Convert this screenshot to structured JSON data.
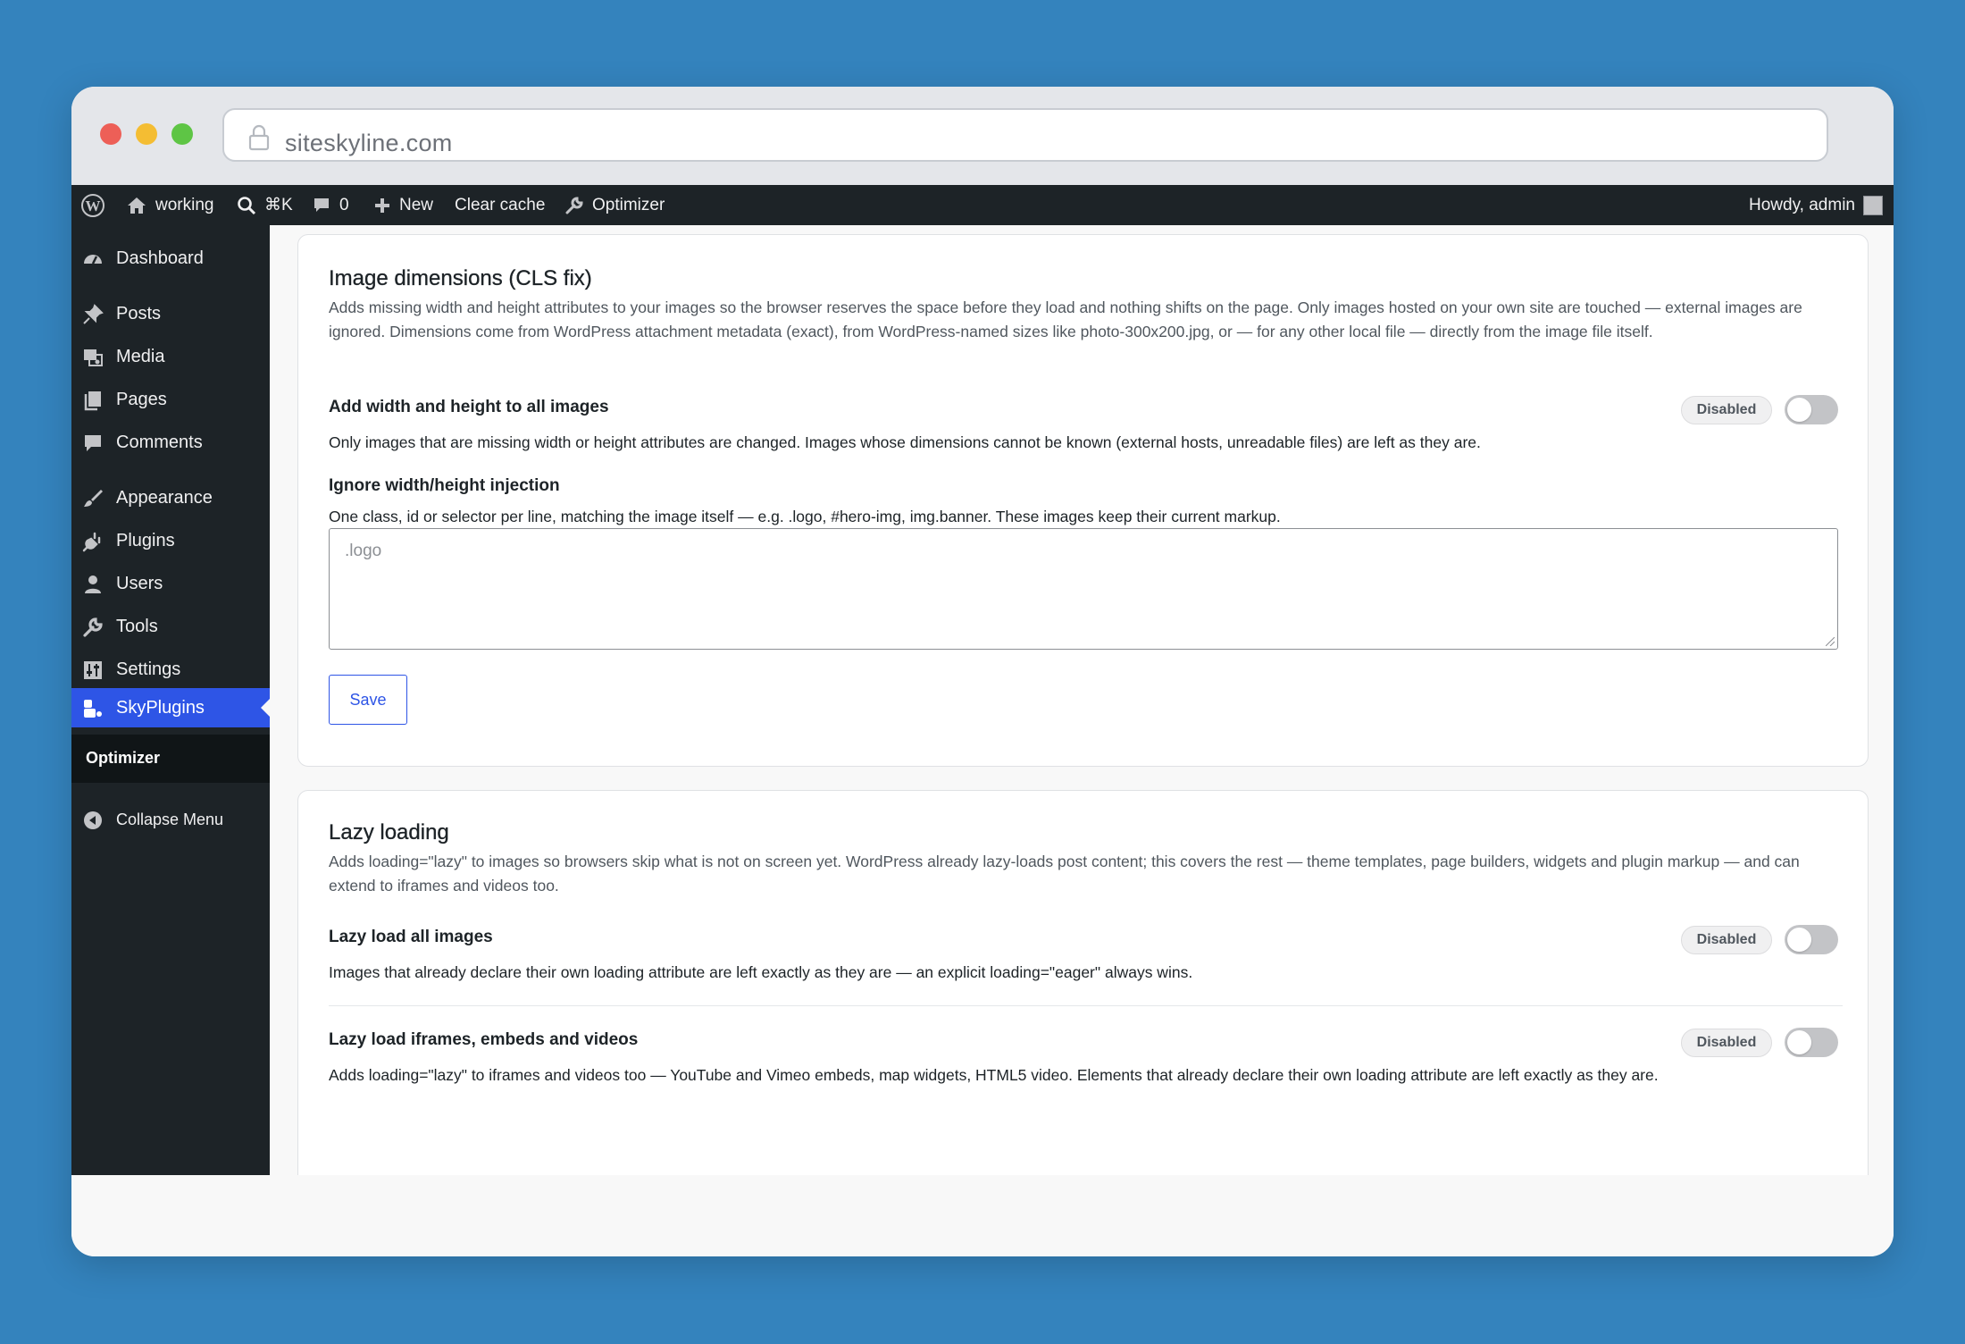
{
  "browser": {
    "url": "siteskyline.com"
  },
  "admin_bar": {
    "site_name": "working",
    "search_shortcut": "⌘K",
    "comments_count": "0",
    "new_label": "New",
    "clear_cache_label": "Clear cache",
    "optimizer_label": "Optimizer",
    "howdy": "Howdy, admin"
  },
  "sidebar": {
    "items": [
      {
        "label": "Dashboard",
        "icon": "dashboard-icon"
      },
      {
        "label": "Posts",
        "icon": "pin-icon"
      },
      {
        "label": "Media",
        "icon": "media-icon"
      },
      {
        "label": "Pages",
        "icon": "pages-icon"
      },
      {
        "label": "Comments",
        "icon": "comment-icon"
      },
      {
        "label": "Appearance",
        "icon": "brush-icon"
      },
      {
        "label": "Plugins",
        "icon": "plug-icon"
      },
      {
        "label": "Users",
        "icon": "user-icon"
      },
      {
        "label": "Tools",
        "icon": "wrench-icon"
      },
      {
        "label": "Settings",
        "icon": "settings-icon"
      },
      {
        "label": "SkyPlugins",
        "icon": "skyplugins-icon"
      }
    ],
    "submenu": "Optimizer",
    "collapse": "Collapse Menu"
  },
  "colors": {
    "accent": "#2e55e6",
    "admin_bar": "#1d2327",
    "background": "#3483bd"
  },
  "image_dimensions": {
    "title": "Image dimensions (CLS fix)",
    "description": "Adds missing width and height attributes to your images so the browser reserves the space before they load and nothing shifts on the page. Only images hosted on your own site are touched — external images are ignored. Dimensions come from WordPress attachment metadata (exact), from WordPress-named sizes like photo-300x200.jpg, or — for any other local file — directly from the image file itself.",
    "setting_title": "Add width and height to all images",
    "setting_status": "Disabled",
    "setting_enabled": false,
    "setting_desc": "Only images that are missing width or height attributes are changed. Images whose dimensions cannot be known (external hosts, unreadable files) are left as they are.",
    "ignore_title": "Ignore width/height injection",
    "ignore_desc": "One class, id or selector per line, matching the image itself — e.g. .logo, #hero-img, img.banner. These images keep their current markup.",
    "ignore_placeholder": ".logo",
    "save_label": "Save"
  },
  "lazy_loading": {
    "title": "Lazy loading",
    "description": "Adds loading=\"lazy\" to images so browsers skip what is not on screen yet. WordPress already lazy-loads post content; this covers the rest — theme templates, page builders, widgets and plugin markup — and can extend to iframes and videos too.",
    "settings": [
      {
        "title": "Lazy load all images",
        "status": "Disabled",
        "enabled": false,
        "desc": "Images that already declare their own loading attribute are left exactly as they are — an explicit loading=\"eager\" always wins."
      },
      {
        "title": "Lazy load iframes, embeds and videos",
        "status": "Disabled",
        "enabled": false,
        "desc": "Adds loading=\"lazy\" to iframes and videos too — YouTube and Vimeo embeds, map widgets, HTML5 video. Elements that already declare their own loading attribute are left exactly as they are."
      }
    ]
  }
}
